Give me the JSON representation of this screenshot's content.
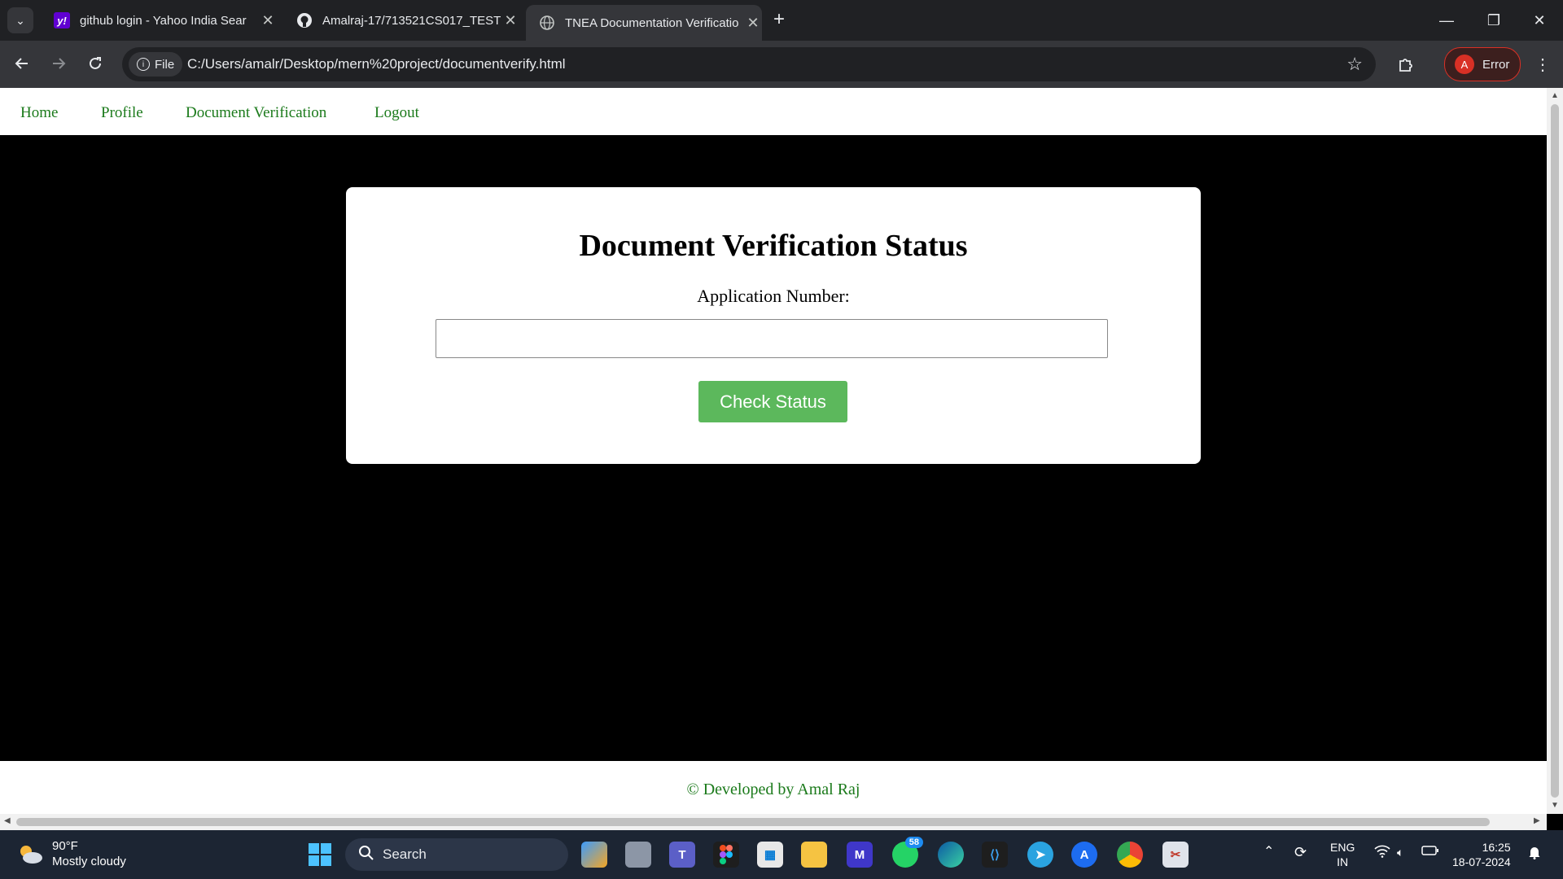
{
  "browser": {
    "tabs": [
      {
        "title": "github login - Yahoo India Sear",
        "favicon": "yahoo-icon"
      },
      {
        "title": "Amalraj-17/713521CS017_TEST",
        "favicon": "github-icon"
      },
      {
        "title": "TNEA Documentation Verificatio",
        "favicon": "globe-icon",
        "active": true
      }
    ],
    "url_chip": "File",
    "url": "C:/Users/amalr/Desktop/mern%20project/documentverify.html",
    "profile_initial": "A",
    "profile_label": "Error"
  },
  "nav": {
    "items": [
      "Home",
      "Profile",
      "Document Verification",
      "Logout"
    ]
  },
  "card": {
    "title": "Document Verification Status",
    "label": "Application Number:",
    "input_value": "",
    "button": "Check Status"
  },
  "footer": {
    "text": "© Developed by Amal Raj"
  },
  "taskbar": {
    "weather_temp": "90°F",
    "weather_desc": "Mostly cloudy",
    "search_placeholder": "Search",
    "whatsapp_badge": "58",
    "lang_top": "ENG",
    "lang_bottom": "IN",
    "time": "16:25",
    "date": "18-07-2024"
  },
  "colors": {
    "nav_link": "#1b7a1b",
    "button": "#5cb85c",
    "page_bg": "#000000"
  }
}
